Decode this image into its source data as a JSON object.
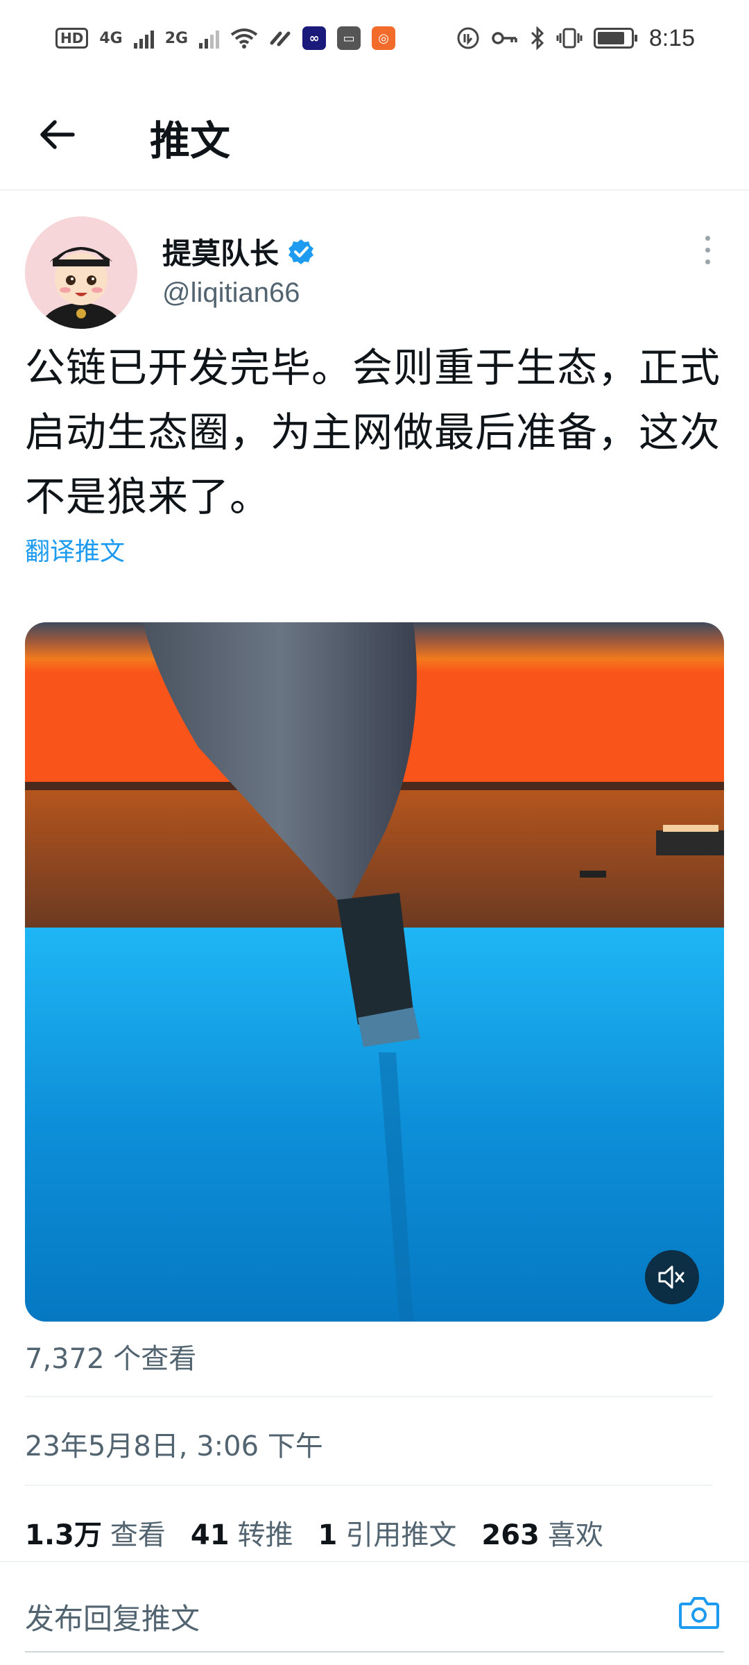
{
  "status_bar": {
    "hd": "HD",
    "net1": "4G",
    "net2": "2G",
    "time": "8:15"
  },
  "header": {
    "title": "推文"
  },
  "tweet": {
    "author_name": "提莫队长",
    "handle": "@liqitian66",
    "text": "公链已开发完毕。会则重于生态，正式启动生态圈，为主网做最后准备，这次不是狼来了。",
    "translate_label": "翻译推文",
    "views_line": "7,372 个查看",
    "timestamp": "23年5月8日, 3:06 下午"
  },
  "stats": [
    {
      "value": "1.3万",
      "label": "查看"
    },
    {
      "value": "41",
      "label": "转推"
    },
    {
      "value": "1",
      "label": "引用推文"
    },
    {
      "value": "263",
      "label": "喜欢"
    }
  ],
  "reply": {
    "placeholder": "发布回复推文"
  },
  "icons": {
    "back": "arrow-left-icon",
    "verified": "verified-badge-icon",
    "more": "more-vertical-icon",
    "mute": "volume-muted-icon",
    "camera": "camera-icon"
  },
  "colors": {
    "accent": "#1d9bf0",
    "text_primary": "#0f1419",
    "text_secondary": "#536471"
  }
}
